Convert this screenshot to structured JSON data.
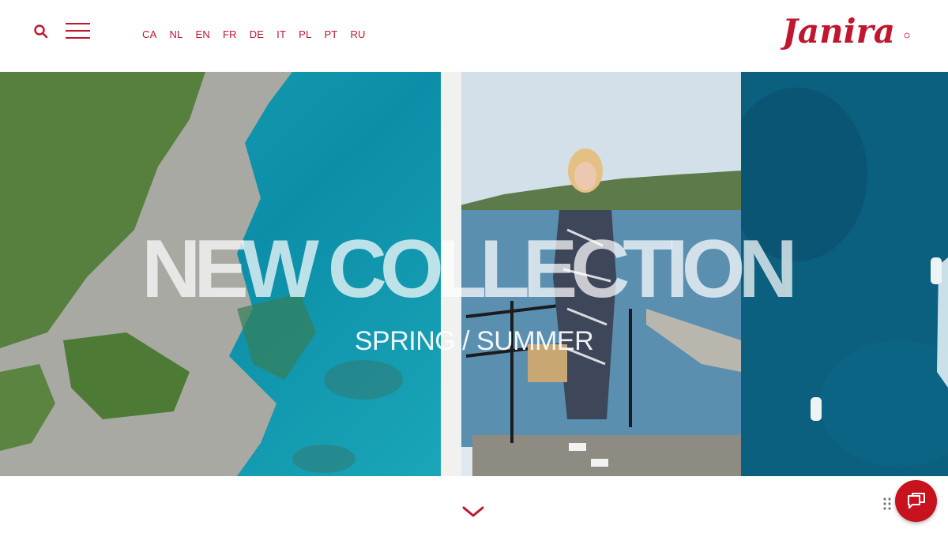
{
  "header": {
    "languages": [
      "CA",
      "NL",
      "EN",
      "FR",
      "DE",
      "IT",
      "PL",
      "PT",
      "RU"
    ],
    "logo_text": "Janira",
    "icons": {
      "search": "search-icon",
      "menu": "hamburger-menu-icon"
    }
  },
  "hero": {
    "headline": "NEW COLLECTION",
    "subline": "SPRING / SUMMER"
  },
  "footer": {
    "icons": {
      "scroll": "chevron-down-icon",
      "chat": "chat-icon",
      "drag": "drag-handle-icon"
    }
  },
  "colors": {
    "brand": "#c0162e",
    "chat_button": "#c8121d"
  }
}
